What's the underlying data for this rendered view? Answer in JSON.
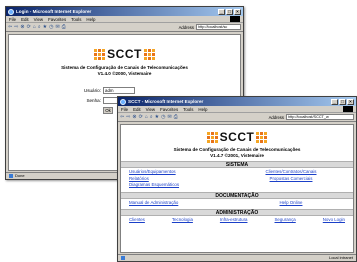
{
  "colors": {
    "title_bar": "#0a246a",
    "link": "#1a3fc8",
    "section_bg": "#d9d9d9",
    "logo_orange": "#f5a623"
  },
  "back_window": {
    "title": "Login - Microsoft Internet Explorer",
    "menu": [
      "File",
      "Edit",
      "View",
      "Favorites",
      "Tools",
      "Help"
    ],
    "address_label": "Address",
    "address_value": "http://localhost/sc",
    "logo_text": "SCCT",
    "system_name": "Sistema de Configuração de Canais de Telecomunicações",
    "version": "V1.4.0 ©2000, Vistemaire",
    "login": {
      "user_label": "Usuário:",
      "user_value": "adm",
      "password_label": "Senha:",
      "password_value": "",
      "button_label": "Ok"
    },
    "status": "Done"
  },
  "front_window": {
    "title": "SCCT - Microsoft Internet Explorer",
    "menu": [
      "File",
      "Edit",
      "View",
      "Favorites",
      "Tools",
      "Help"
    ],
    "address_label": "Address",
    "address_value": "http://localhost/SCCT_w",
    "logo_text": "SCCT",
    "system_name": "Sistema de Configuração de Canais de Telecomunicações",
    "version": "V1.4.7 ©2001, Vistemaire",
    "sections": {
      "sistema": {
        "title": "SISTEMA",
        "links": [
          "Usuários/Equipamentos",
          "Clientes/Contratos/Canais",
          "Relatórios",
          "Propostas Comerciais",
          "Diagramas Esquemáticos"
        ]
      },
      "documentacao": {
        "title": "DOCUMENTAÇÃO",
        "links": [
          "Manual de Administração",
          "Help Online"
        ]
      },
      "administracao": {
        "title": "ADMINISTRAÇÃO",
        "links": [
          "Clientes",
          "Tecnologia",
          "Infra-estrutura",
          "Segurança",
          "Novo Login"
        ]
      }
    },
    "status_zone": "Local intranet"
  }
}
